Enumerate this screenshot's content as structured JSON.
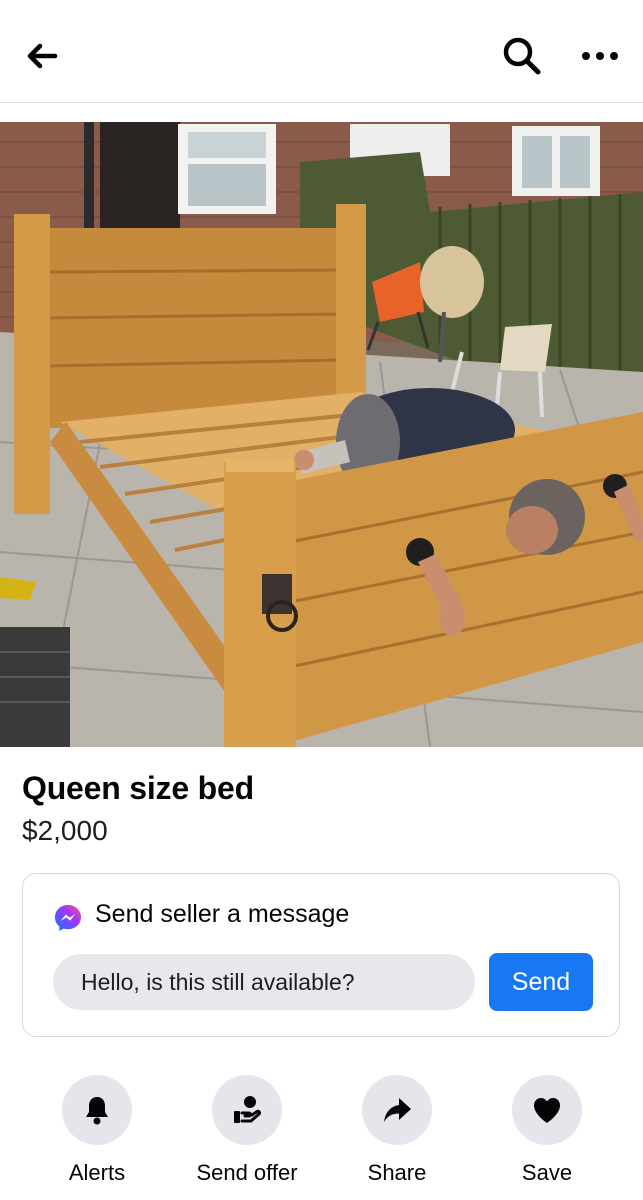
{
  "header": {
    "back_icon": "arrow-left-icon",
    "search_icon": "search-icon",
    "more_icon": "more-horizontal-icon"
  },
  "listing": {
    "title": "Queen size bed",
    "price": "$2,000"
  },
  "message": {
    "icon": "messenger-icon",
    "title": "Send seller a message",
    "input_value": "Hello, is this still available?",
    "send_label": "Send"
  },
  "actions": [
    {
      "label": "Alerts",
      "icon": "bell-icon"
    },
    {
      "label": "Send offer",
      "icon": "offer-icon"
    },
    {
      "label": "Share",
      "icon": "share-icon"
    },
    {
      "label": "Save",
      "icon": "heart-icon"
    }
  ],
  "colors": {
    "accent": "#1877f2",
    "action_bg": "#e4e6eb",
    "input_bg": "#e6e8ec"
  }
}
